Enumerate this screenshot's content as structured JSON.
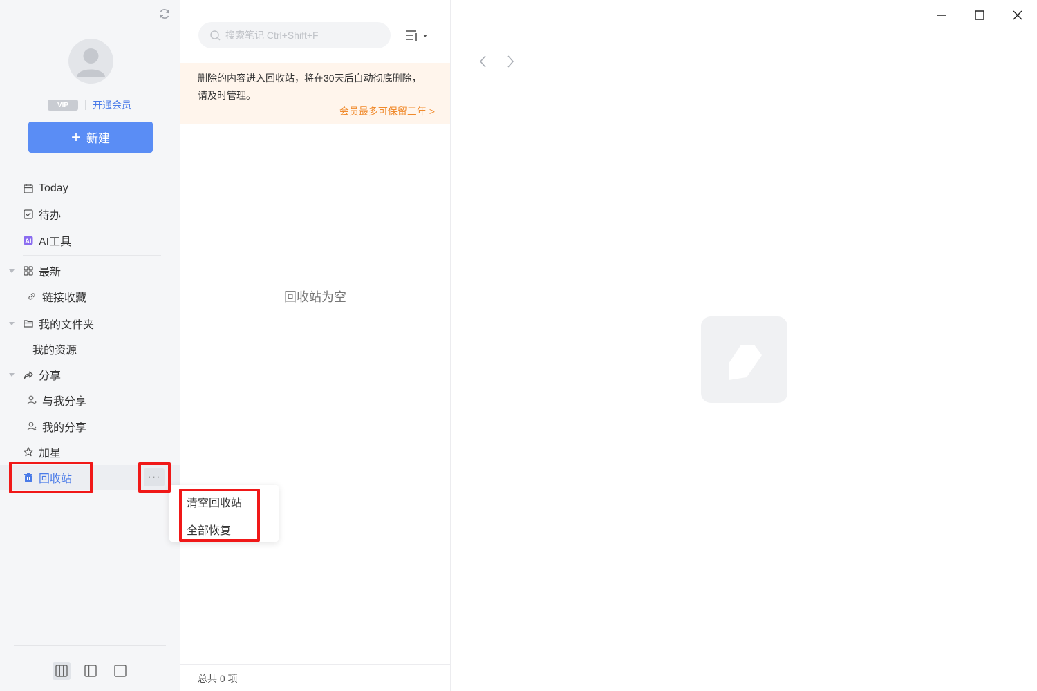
{
  "sidebar": {
    "vip_badge": "VIP",
    "vip_link": "开通会员",
    "new_button": "新建",
    "items": {
      "today": "Today",
      "todo": "待办",
      "ai_tools": "AI工具",
      "recent": "最新",
      "link_collection": "链接收藏",
      "my_folder": "我的文件夹",
      "my_resources": "我的资源",
      "share": "分享",
      "shared_with_me": "与我分享",
      "my_shares": "我的分享",
      "starred": "加星",
      "recycle_bin": "回收站"
    },
    "more_label": "···"
  },
  "context_menu": {
    "empty_bin": "清空回收站",
    "restore_all": "全部恢复"
  },
  "list": {
    "search_placeholder": "搜索笔记 Ctrl+Shift+F",
    "notice_text": "删除的内容进入回收站，将在30天后自动彻底删除，请及时管理。",
    "notice_link": "会员最多可保留三年",
    "empty_text": "回收站为空",
    "footer": "总共 0 项"
  },
  "colors": {
    "accent": "#5a8df5",
    "highlight": "#f01818",
    "notice_bg": "#fff5ec",
    "notice_link": "#f08a2c"
  },
  "icons": {
    "sync": "sync-icon",
    "avatar": "avatar-icon",
    "today": "calendar-icon",
    "todo": "checkbox-icon",
    "ai": "ai-icon",
    "recent": "grid-icon",
    "link": "link-icon",
    "folder": "folder-icon",
    "share": "share-icon",
    "user": "user-icon",
    "star": "star-icon",
    "trash": "trash-icon",
    "search": "search-icon",
    "sort": "sort-icon",
    "edit": "pencil-icon"
  }
}
